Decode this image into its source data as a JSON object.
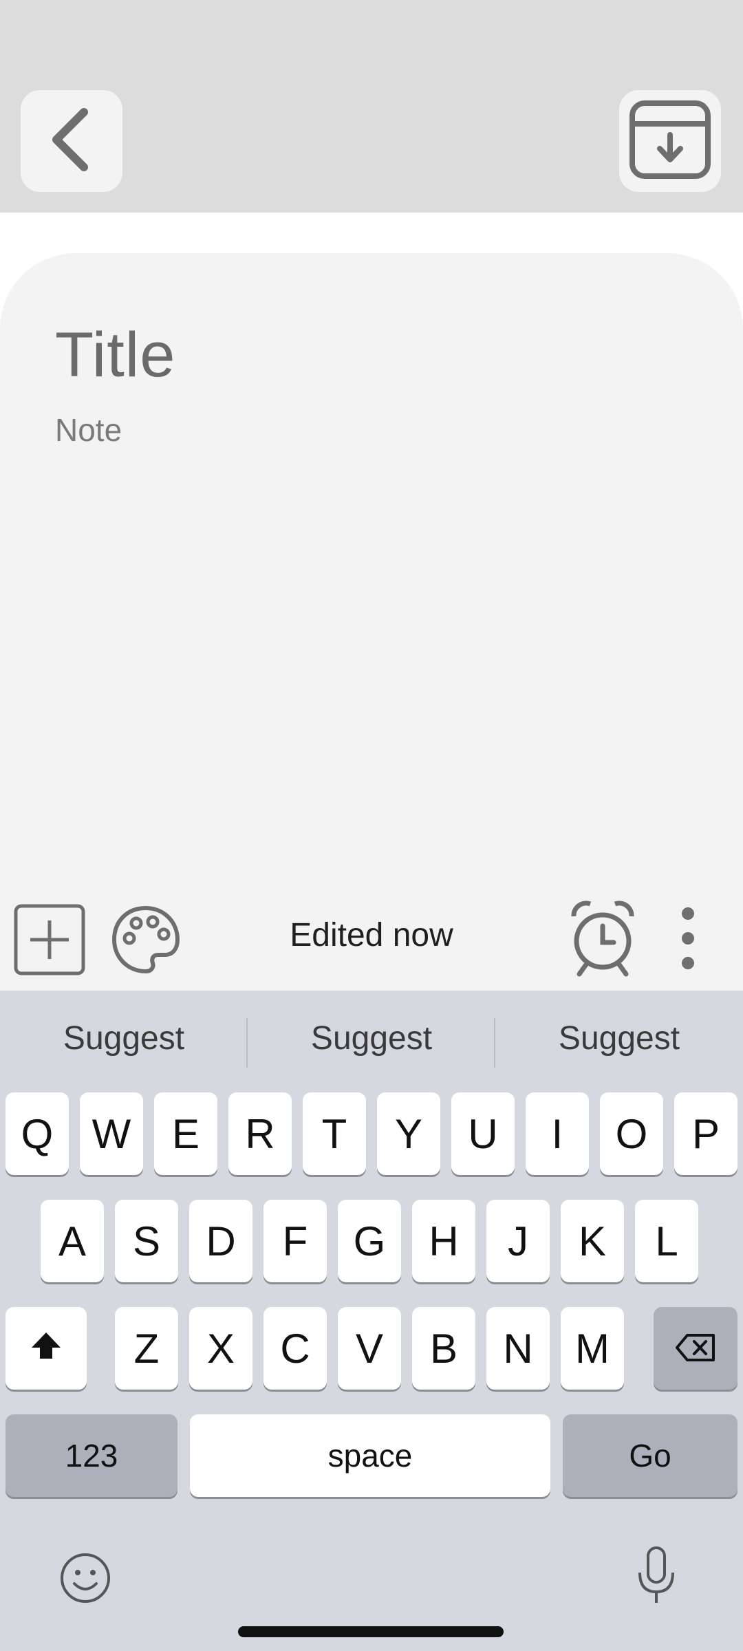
{
  "colors": {
    "topbar": "#dcdcdc",
    "card": "#f3f3f3",
    "keyboard": "#d5d8de",
    "key": "#ffffff",
    "key_dark": "#abb0ba",
    "icon": "#6e6e6e"
  },
  "header": {
    "back_icon": "chevron-left-icon",
    "save_icon": "download-box-icon"
  },
  "note": {
    "title_placeholder": "Title",
    "body_placeholder": "Note"
  },
  "toolbar": {
    "status": "Edited now",
    "icons": [
      "add-box-icon",
      "palette-icon",
      "alarm-clock-icon",
      "more-vert-icon"
    ]
  },
  "keyboard": {
    "suggestions": [
      "Suggest",
      "Suggest",
      "Suggest"
    ],
    "row1": [
      "Q",
      "W",
      "E",
      "R",
      "T",
      "Y",
      "U",
      "I",
      "O",
      "P"
    ],
    "row2": [
      "A",
      "S",
      "D",
      "F",
      "G",
      "H",
      "J",
      "K",
      "L"
    ],
    "row3": [
      "Z",
      "X",
      "C",
      "V",
      "B",
      "N",
      "M"
    ],
    "numbers_label": "123",
    "space_label": "space",
    "go_label": "Go",
    "icons": [
      "shift-icon",
      "backspace-icon",
      "emoji-icon",
      "microphone-icon"
    ]
  }
}
